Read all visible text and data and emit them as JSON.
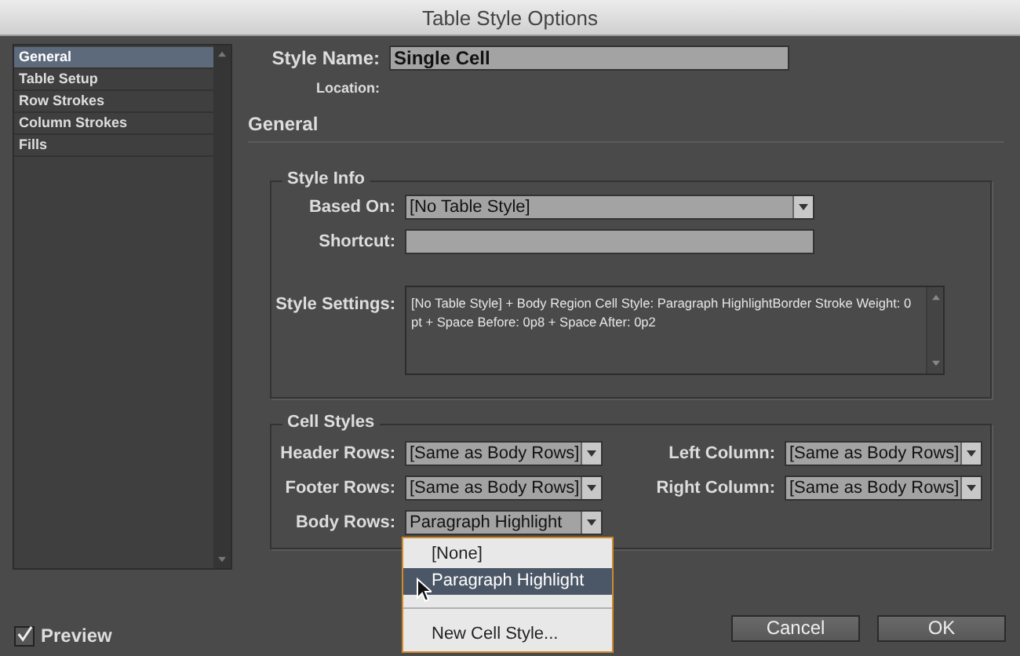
{
  "window": {
    "title": "Table Style Options"
  },
  "sidebar": {
    "items": [
      {
        "label": "General",
        "selected": true
      },
      {
        "label": "Table Setup",
        "selected": false
      },
      {
        "label": "Row Strokes",
        "selected": false
      },
      {
        "label": "Column Strokes",
        "selected": false
      },
      {
        "label": "Fills",
        "selected": false
      }
    ]
  },
  "style_name": {
    "label": "Style Name:",
    "value": "Single Cell"
  },
  "location": {
    "label": "Location:"
  },
  "section_title": "General",
  "style_info": {
    "legend": "Style Info",
    "based_on": {
      "label": "Based On:",
      "value": "[No Table Style]"
    },
    "shortcut": {
      "label": "Shortcut:"
    },
    "style_settings": {
      "label": "Style Settings:",
      "value": "[No Table Style] + Body Region Cell Style: Paragraph HighlightBorder Stroke Weight: 0 pt + Space Before: 0p8 + Space After: 0p2"
    }
  },
  "cell_styles": {
    "legend": "Cell Styles",
    "fields": [
      {
        "label": "Header Rows:",
        "value": "[Same as Body Rows]"
      },
      {
        "label": "Left Column:",
        "value": "[Same as Body Rows]"
      },
      {
        "label": "Footer Rows:",
        "value": "[Same as Body Rows]"
      },
      {
        "label": "Right Column:",
        "value": "[Same as Body Rows]"
      },
      {
        "label": "Body Rows:",
        "value": "Paragraph Highlight"
      }
    ]
  },
  "dropdown_menu": {
    "items": [
      {
        "kind": "item",
        "label": "[None]",
        "selected": false
      },
      {
        "kind": "item",
        "label": "Paragraph Highlight",
        "selected": true
      },
      {
        "kind": "separator"
      },
      {
        "kind": "item",
        "label": "New Cell Style...",
        "selected": false
      }
    ]
  },
  "preview": {
    "label": "Preview",
    "checked": true
  },
  "buttons": [
    "Cancel",
    "OK"
  ]
}
